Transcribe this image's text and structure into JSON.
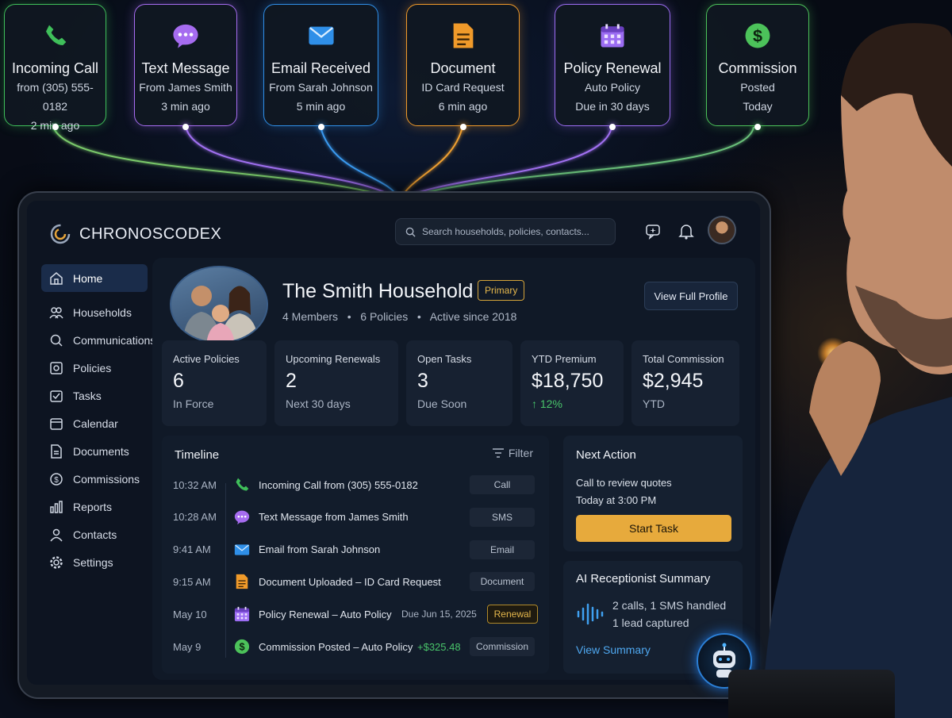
{
  "notifications": [
    {
      "title": "Incoming Call",
      "line1": "from (305) 555-0182",
      "line2": "2 min ago",
      "color": "#3fbf5a",
      "icon": "phone-icon"
    },
    {
      "title": "Text Message",
      "line1": "From James Smith",
      "line2": "3 min ago",
      "color": "#a66cf0",
      "icon": "chat-bubble-icon"
    },
    {
      "title": "Email Received",
      "line1": "From Sarah Johnson",
      "line2": "5 min ago",
      "color": "#2f8fe8",
      "icon": "envelope-icon"
    },
    {
      "title": "Document",
      "line1": "ID Card Request",
      "line2": "6 min ago",
      "color": "#f09a2a",
      "icon": "document-icon"
    },
    {
      "title": "Policy Renewal",
      "line1": "Auto Policy",
      "line2": "Due in 30 days",
      "color": "#9b6cf2",
      "icon": "calendar-icon"
    },
    {
      "title": "Commission",
      "line1": "Posted",
      "line2": "Today",
      "color": "#4cc25a",
      "icon": "dollar-coin-icon"
    }
  ],
  "app": {
    "brand_part1": "CHRONOS",
    "brand_part2": "CODEX",
    "search_placeholder": "Search households, policies, contacts..."
  },
  "sidebar": {
    "items": [
      {
        "label": "Home",
        "icon": "home-icon",
        "active": true
      },
      {
        "label": "Households",
        "icon": "people-icon"
      },
      {
        "label": "Communications",
        "icon": "search-icon"
      },
      {
        "label": "Policies",
        "icon": "policy-icon"
      },
      {
        "label": "Tasks",
        "icon": "tasks-icon"
      },
      {
        "label": "Calendar",
        "icon": "calendar-icon"
      },
      {
        "label": "Documents",
        "icon": "document-icon"
      },
      {
        "label": "Commissions",
        "icon": "dollar-icon"
      },
      {
        "label": "Reports",
        "icon": "reports-icon"
      },
      {
        "label": "Contacts",
        "icon": "contact-icon"
      },
      {
        "label": "Settings",
        "icon": "gear-icon"
      }
    ]
  },
  "household": {
    "title": "The Smith Household",
    "badge": "Primary",
    "members": "4 Members",
    "policies": "6 Policies",
    "active_since": "Active since 2018",
    "sep": "•",
    "view_profile": "View Full Profile"
  },
  "stats": [
    {
      "label": "Active Policies",
      "value": "6",
      "sub": "In Force"
    },
    {
      "label": "Upcoming Renewals",
      "value": "2",
      "sub": "Next 30 days"
    },
    {
      "label": "Open Tasks",
      "value": "3",
      "sub": "Due Soon"
    },
    {
      "label": "YTD Premium",
      "value": "$18,750",
      "sub": "↑ 12%",
      "sub_color": "#49c46a"
    },
    {
      "label": "Total Commission",
      "value": "$2,945",
      "sub": "YTD"
    }
  ],
  "timeline": {
    "title": "Timeline",
    "filter": "Filter",
    "rows": [
      {
        "time": "10:32 AM",
        "text": "Incoming Call from (305) 555-0182",
        "tag": "Call",
        "icon": "phone-icon",
        "color": "#3fbf5a",
        "extra": ""
      },
      {
        "time": "10:28 AM",
        "text": "Text Message from James Smith",
        "tag": "SMS",
        "icon": "chat-bubble-icon",
        "color": "#a66cf0",
        "extra": ""
      },
      {
        "time": "9:41 AM",
        "text": "Email from Sarah Johnson",
        "tag": "Email",
        "icon": "envelope-icon",
        "color": "#2f8fe8",
        "extra": ""
      },
      {
        "time": "9:15 AM",
        "text": "Document Uploaded – ID Card Request",
        "tag": "Document",
        "icon": "document-icon",
        "color": "#f09a2a",
        "extra": ""
      },
      {
        "time": "May 10",
        "text": "Policy Renewal – Auto Policy",
        "tag": "Renewal",
        "icon": "calendar-icon",
        "color": "#9b6cf2",
        "extra": "Due Jun 15, 2025"
      },
      {
        "time": "May 9",
        "text": "Commission Posted – Auto Policy",
        "tag": "Commission",
        "icon": "dollar-coin-icon",
        "color": "#4cc25a",
        "extra": "+$325.48"
      }
    ]
  },
  "next_action": {
    "title": "Next Action",
    "line1": "Call to review quotes",
    "line2": "Today at 3:00 PM",
    "button": "Start Task"
  },
  "ai_summary": {
    "title": "AI Receptionist Summary",
    "line1": "2 calls, 1 SMS handled",
    "line2": "1 lead captured",
    "link": "View Summary"
  }
}
